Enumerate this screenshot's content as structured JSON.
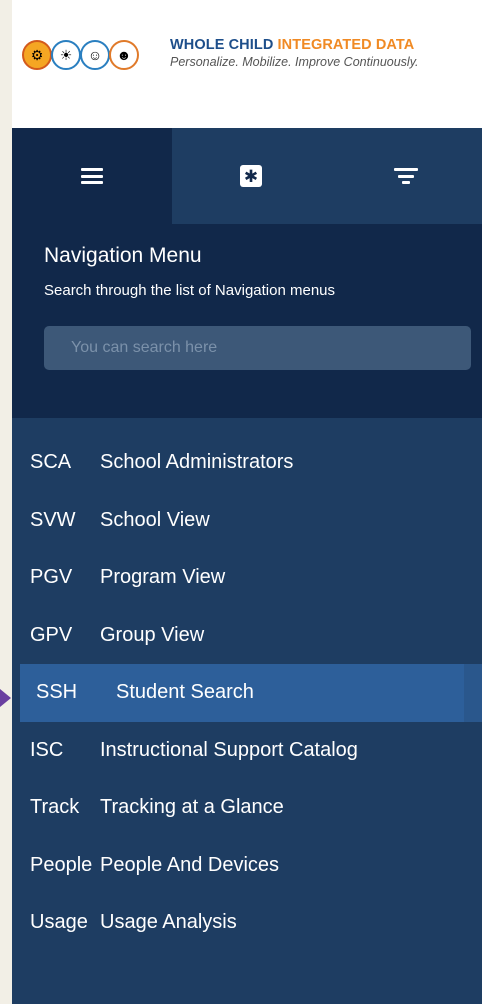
{
  "brand": {
    "title_part1": "WHOLE CHILD",
    "title_part2": "INTEGRATED DATA",
    "tagline": "Personalize. Mobilize. Improve Continuously."
  },
  "tabs": [
    {
      "icon": "hamburger-menu-icon"
    },
    {
      "icon": "gear-icon"
    },
    {
      "icon": "filter-icon"
    }
  ],
  "nav": {
    "title": "Navigation Menu",
    "subtitle": "Search through the list of Navigation menus",
    "search_placeholder": "You can search here",
    "search_value": ""
  },
  "menu": [
    {
      "code": "SCA",
      "label": "School Administrators",
      "active": false
    },
    {
      "code": "SVW",
      "label": "School View",
      "active": false
    },
    {
      "code": "PGV",
      "label": "Program View",
      "active": false
    },
    {
      "code": "GPV",
      "label": "Group View",
      "active": false
    },
    {
      "code": "SSH",
      "label": "Student Search",
      "active": true
    },
    {
      "code": "ISC",
      "label": "Instructional Support Catalog",
      "active": false
    },
    {
      "code": "Track",
      "label": "Tracking at a Glance",
      "active": false
    },
    {
      "code": "People",
      "label": "People And Devices",
      "active": false
    },
    {
      "code": "Usage",
      "label": "Usage Analysis",
      "active": false
    }
  ],
  "colors": {
    "panel": "#1e3d62",
    "panel_dark": "#11284a",
    "active_item": "#2d5f9a",
    "brand_blue": "#1d4e8a",
    "brand_orange": "#f08a24",
    "pointer": "#6a3fa0"
  }
}
